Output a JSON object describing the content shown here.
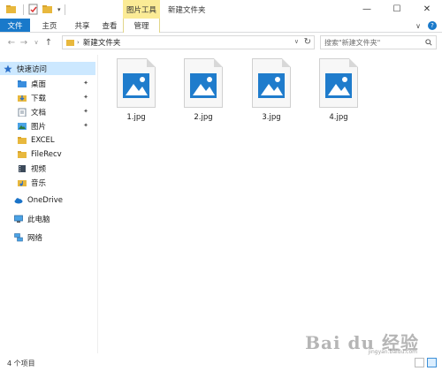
{
  "title_bar": {
    "window_title": "新建文件夹",
    "context_tab_title": "图片工具",
    "controls": {
      "minimize": "—",
      "maximize": "☐",
      "close": "✕"
    },
    "quick_access_dropdown": "▾"
  },
  "ribbon": {
    "tabs": [
      {
        "label": "文件"
      },
      {
        "label": "主页"
      },
      {
        "label": "共享"
      },
      {
        "label": "查看"
      },
      {
        "label": "管理"
      }
    ],
    "expand_glyph": "∨",
    "help_glyph": "?"
  },
  "address_bar": {
    "back": "←",
    "forward": "→",
    "recent": "∨",
    "up": "↑",
    "path_separator": "›",
    "path": "新建文件夹",
    "dropdown": "∨",
    "refresh": "↻"
  },
  "search": {
    "placeholder": "搜索\"新建文件夹\""
  },
  "nav_pane": {
    "quick_access": "快速访问",
    "items": [
      {
        "label": "桌面",
        "pinned": true
      },
      {
        "label": "下载",
        "pinned": true
      },
      {
        "label": "文档",
        "pinned": true
      },
      {
        "label": "图片",
        "pinned": true
      },
      {
        "label": "EXCEL"
      },
      {
        "label": "FileRecv"
      },
      {
        "label": "视频"
      },
      {
        "label": "音乐"
      }
    ],
    "onedrive": "OneDrive",
    "this_pc": "此电脑",
    "network": "网络",
    "pin_glyph": "✦"
  },
  "files": [
    {
      "name": "1.jpg"
    },
    {
      "name": "2.jpg"
    },
    {
      "name": "3.jpg"
    },
    {
      "name": "4.jpg"
    }
  ],
  "status_bar": {
    "item_count": "4 个项目"
  },
  "watermark": {
    "text": "Bai du 经验",
    "sub": "jingyan.baidu.com"
  },
  "colors": {
    "accent": "#1979ca",
    "context_tab": "#fbeb96",
    "selection": "#cce8ff",
    "image_icon": "#1f7ccc",
    "folder": "#e8b83d"
  }
}
